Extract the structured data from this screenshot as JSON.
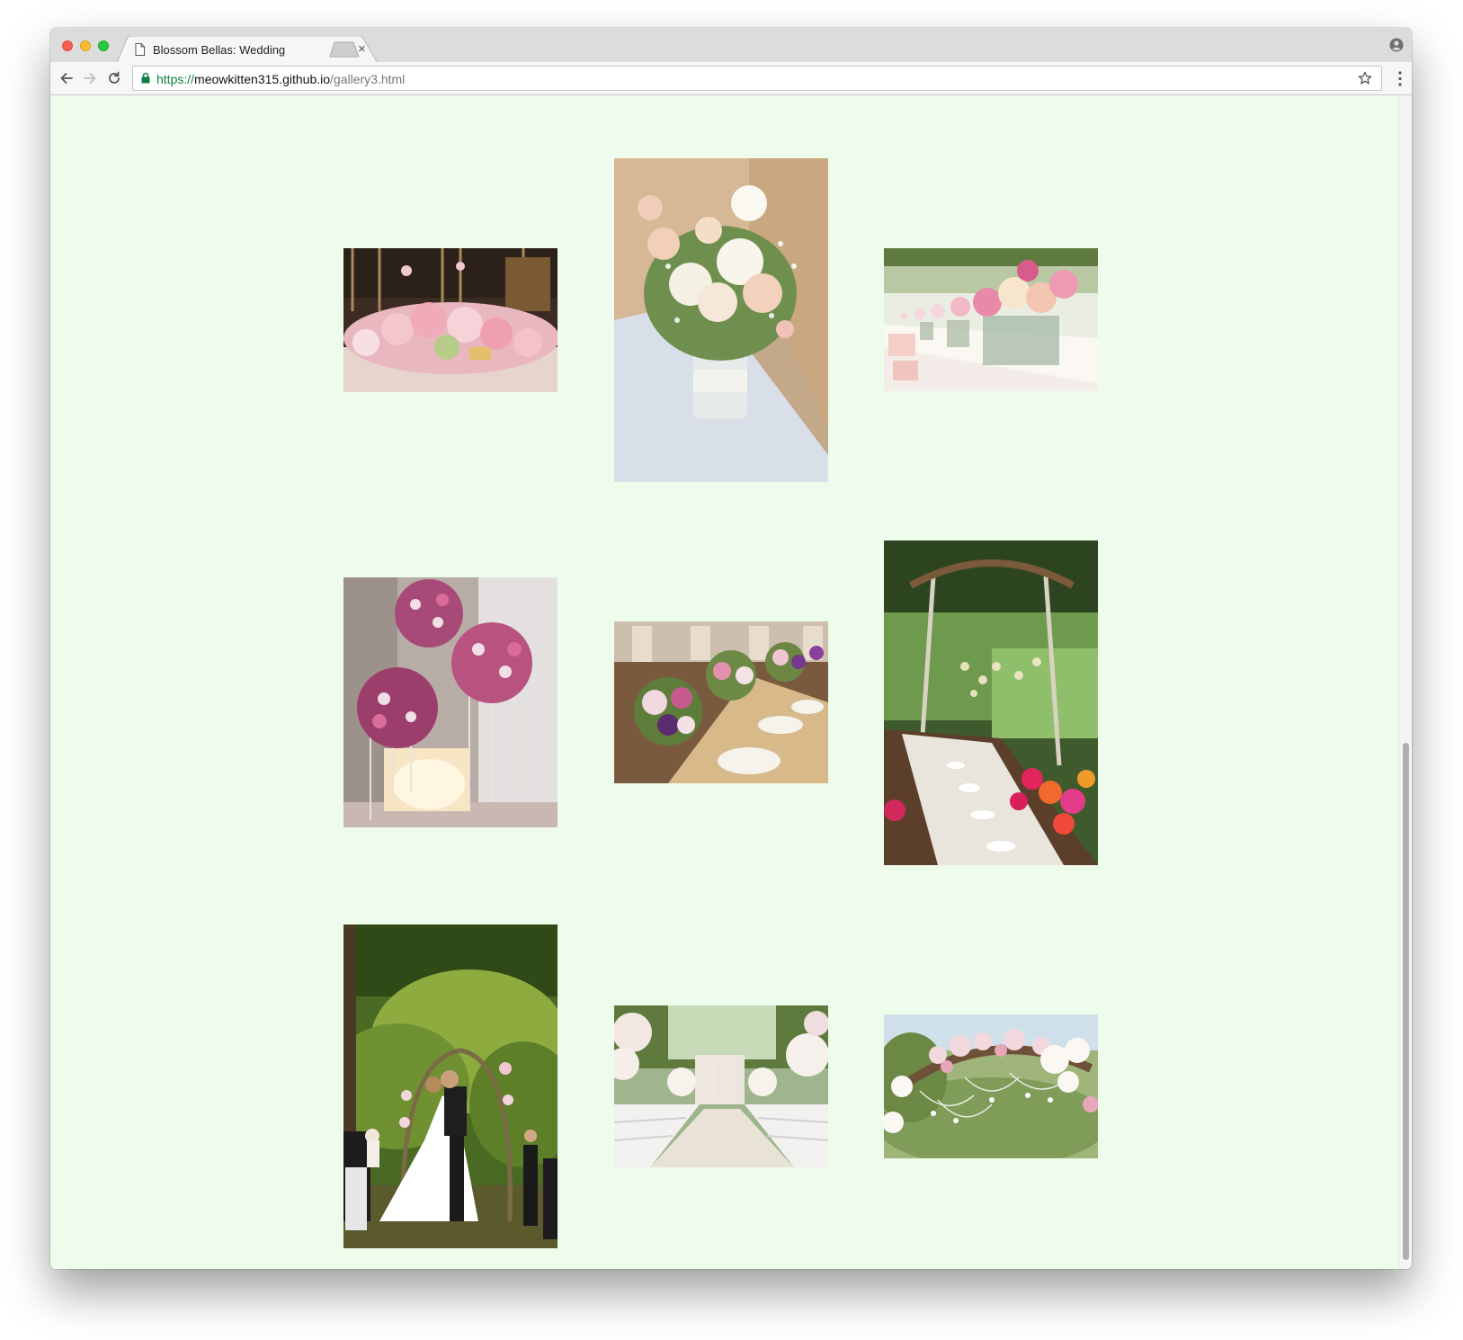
{
  "browser": {
    "tab": {
      "title": "Blossom Bellas: Wedding",
      "close_label": "×"
    },
    "address_bar": {
      "scheme": "https://",
      "host": "meowkitten315.github.io",
      "path": "/gallery3.html"
    }
  },
  "page": {
    "background": "#eefcec",
    "gallery": {
      "photos": [
        {
          "subject": "pink-rose-centerpiece",
          "orientation": "landscape"
        },
        {
          "subject": "mason-jar-bouquet",
          "orientation": "portrait"
        },
        {
          "subject": "rose-vases-table-row",
          "orientation": "landscape"
        },
        {
          "subject": "flower-ball-crystal-stands",
          "orientation": "portrait"
        },
        {
          "subject": "table-setting-florals",
          "orientation": "landscape"
        },
        {
          "subject": "garden-pergola-banquet",
          "orientation": "portrait"
        },
        {
          "subject": "couple-under-floral-arch",
          "orientation": "portrait"
        },
        {
          "subject": "outdoor-ceremony-aisle",
          "orientation": "landscape"
        },
        {
          "subject": "floral-arch-crystals",
          "orientation": "landscape"
        }
      ]
    }
  }
}
